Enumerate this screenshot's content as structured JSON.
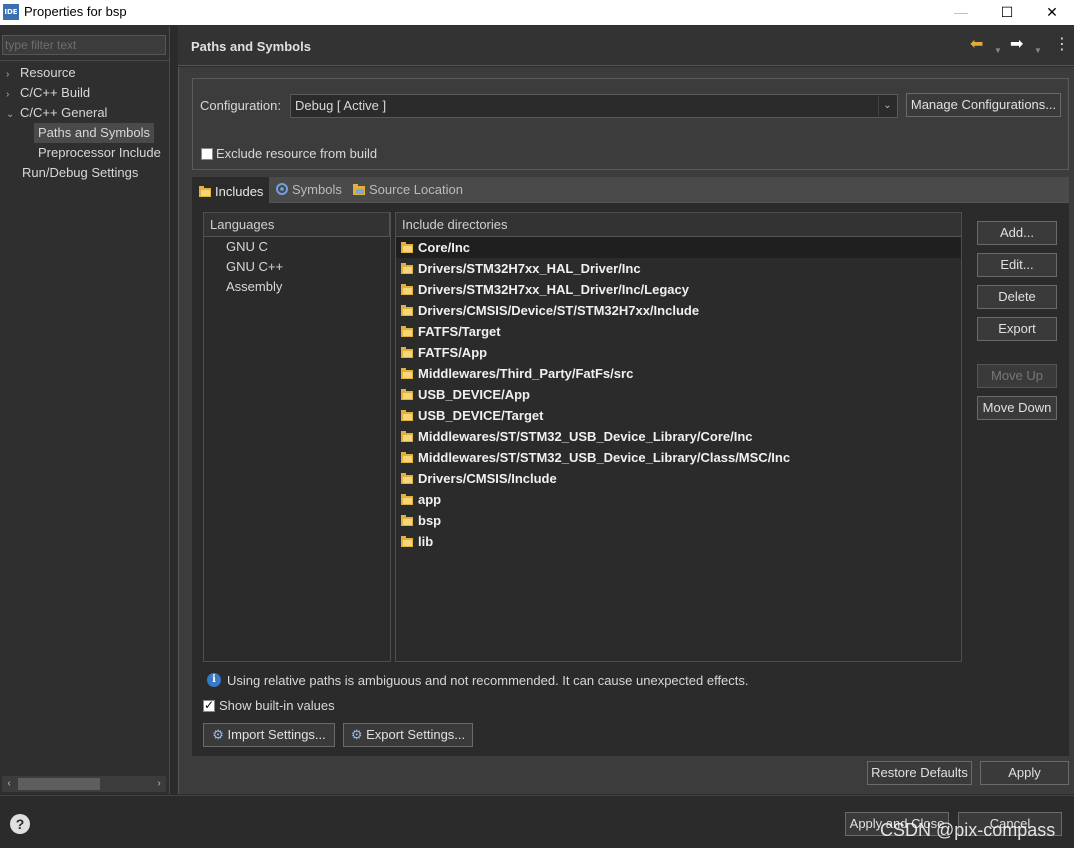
{
  "window": {
    "app_icon": "IDE",
    "title": "Properties for bsp"
  },
  "nav": {
    "filter_placeholder": "type filter text",
    "items": [
      {
        "label": "Resource",
        "twisty": "›"
      },
      {
        "label": "C/C++ Build",
        "twisty": "›"
      },
      {
        "label": "C/C++ General",
        "twisty": "⌄"
      },
      {
        "label": "Paths and Symbols"
      },
      {
        "label": "Preprocessor Include"
      },
      {
        "label": "Run/Debug Settings"
      }
    ]
  },
  "page": {
    "title": "Paths and Symbols"
  },
  "config": {
    "label": "Configuration:",
    "value": "Debug  [ Active ]",
    "manage_label": "Manage Configurations...",
    "exclude_label": "Exclude resource from build"
  },
  "tabs": [
    {
      "label": "Includes",
      "icon": "includes-icon"
    },
    {
      "label": "Symbols",
      "icon": "symbols-icon"
    },
    {
      "label": "Source Location",
      "icon": "source-location-icon"
    }
  ],
  "languages": {
    "header": "Languages",
    "items": [
      "GNU C",
      "GNU C++",
      "Assembly"
    ]
  },
  "includes": {
    "header": "Include directories",
    "items": [
      "Core/Inc",
      "Drivers/STM32H7xx_HAL_Driver/Inc",
      "Drivers/STM32H7xx_HAL_Driver/Inc/Legacy",
      "Drivers/CMSIS/Device/ST/STM32H7xx/Include",
      "FATFS/Target",
      "FATFS/App",
      "Middlewares/Third_Party/FatFs/src",
      "USB_DEVICE/App",
      "USB_DEVICE/Target",
      "Middlewares/ST/STM32_USB_Device_Library/Core/Inc",
      "Middlewares/ST/STM32_USB_Device_Library/Class/MSC/Inc",
      "Drivers/CMSIS/Include",
      "app",
      "bsp",
      "lib"
    ]
  },
  "side_buttons": {
    "add": "Add...",
    "edit": "Edit...",
    "delete": "Delete",
    "export": "Export",
    "move_up": "Move Up",
    "move_down": "Move Down"
  },
  "info_text": "Using relative paths is ambiguous and not recommended. It can cause unexpected effects.",
  "show_builtin_label": "Show built-in values",
  "import_settings": "Import Settings...",
  "export_settings": "Export Settings...",
  "restore_defaults": "Restore Defaults",
  "apply": "Apply",
  "apply_and_close": "Apply and Close",
  "cancel": "Cancel",
  "watermark": "CSDN @pix-compass"
}
